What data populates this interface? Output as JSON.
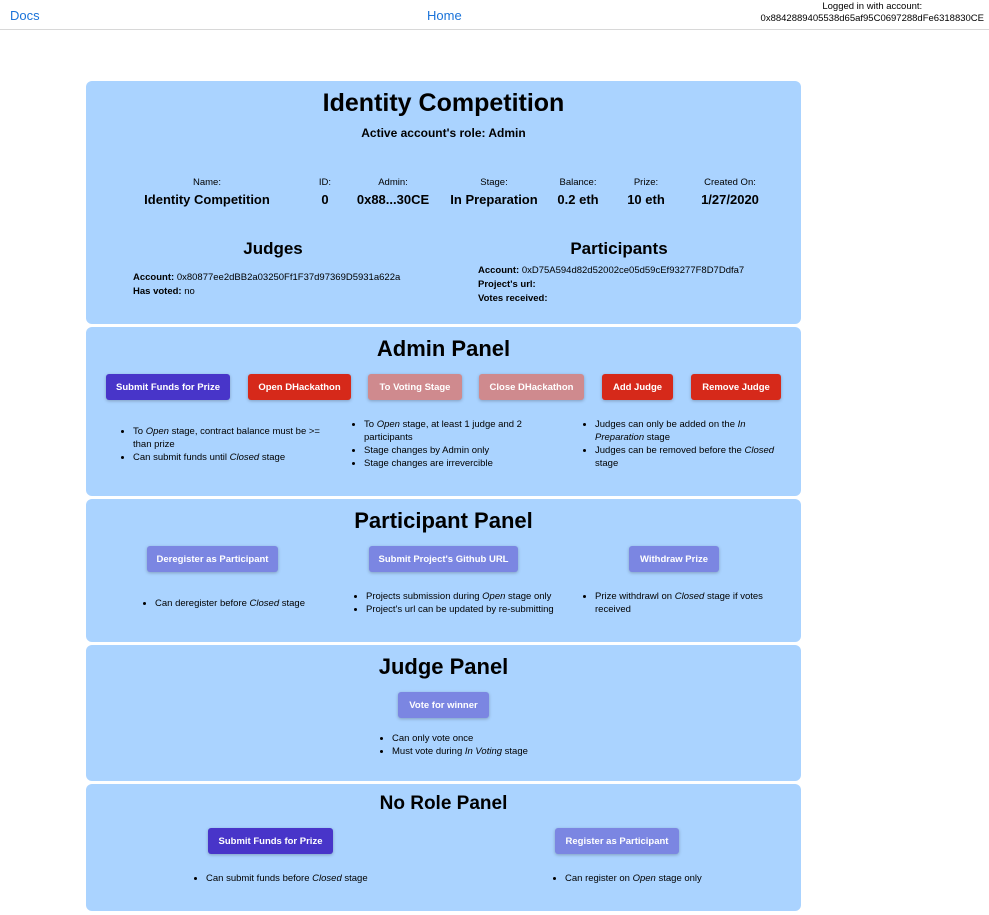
{
  "nav": {
    "docs": "Docs",
    "home": "Home"
  },
  "login": {
    "label": "Logged in with account:",
    "account": "0x8842889405538d65af95C0697288dFe6318830CE"
  },
  "info": {
    "title": "Identity Competition",
    "role": "Active account's role: Admin",
    "stats": [
      {
        "label": "Name:",
        "value": "Identity Competition"
      },
      {
        "label": "ID:",
        "value": "0"
      },
      {
        "label": "Admin:",
        "value": "0x88...30CE"
      },
      {
        "label": "Stage:",
        "value": "In Preparation"
      },
      {
        "label": "Balance:",
        "value": "0.2 eth"
      },
      {
        "label": "Prize:",
        "value": "10 eth"
      },
      {
        "label": "Created On:",
        "value": "1/27/2020"
      }
    ],
    "judges": {
      "heading": "Judges",
      "account_label": "Account:",
      "account": "0x80877ee2dBB2a03250Ff1F37d97369D5931a622a",
      "voted_label": "Has voted:",
      "voted": "no"
    },
    "participants": {
      "heading": "Participants",
      "account_label": "Account:",
      "account": "0xD75A594d82d52002ce05d59cEf93277F8D7Ddfa7",
      "url_label": "Project's url:",
      "url": "",
      "votes_label": "Votes received:",
      "votes": ""
    }
  },
  "admin": {
    "title": "Admin Panel",
    "buttons": [
      "Submit Funds for Prize",
      "Open DHackathon",
      "To Voting Stage",
      "Close DHackathon",
      "Add Judge",
      "Remove Judge"
    ],
    "notes_col1": {
      "a_pre": "To ",
      "a_em": "Open",
      "a_post": " stage, contract balance must be >= than prize",
      "b_pre": "Can submit funds until ",
      "b_em": "Closed",
      "b_post": " stage"
    },
    "notes_col2": {
      "a_pre": "To ",
      "a_em": "Open",
      "a_post": " stage, at least 1 judge and 2 participants",
      "b": "Stage changes by Admin only",
      "c": "Stage changes are irrevercible"
    },
    "notes_col3": {
      "a_pre": "Judges can only be added on the ",
      "a_em": "In Preparation",
      "a_post": " stage",
      "b_pre": "Judges can be removed before the ",
      "b_em": "Closed",
      "b_post": " stage"
    }
  },
  "participant": {
    "title": "Participant Panel",
    "buttons": [
      "Deregister as Participant",
      "Submit Project's Github URL",
      "Withdraw Prize"
    ],
    "notes_col1": {
      "pre": "Can deregister before ",
      "em": "Closed",
      "post": " stage"
    },
    "notes_col2": {
      "a_pre": "Projects submission during ",
      "a_em": "Open",
      "a_post": " stage only",
      "b": "Project's url can be updated by re-submitting"
    },
    "notes_col3": {
      "pre": "Prize withdrawl on ",
      "em": "Closed",
      "post": " stage if votes received"
    }
  },
  "judge": {
    "title": "Judge Panel",
    "button": "Vote for winner",
    "note_a": "Can only vote once",
    "note_b_pre": "Must vote during ",
    "note_b_em": "In Voting",
    "note_b_post": " stage"
  },
  "norole": {
    "title": "No Role Panel",
    "buttons": [
      "Submit Funds for Prize",
      "Register as Participant"
    ],
    "note_1_pre": "Can submit funds before ",
    "note_1_em": "Closed",
    "note_1_post": " stage",
    "note_2_pre": "Can register on ",
    "note_2_em": "Open",
    "note_2_post": " stage only"
  }
}
